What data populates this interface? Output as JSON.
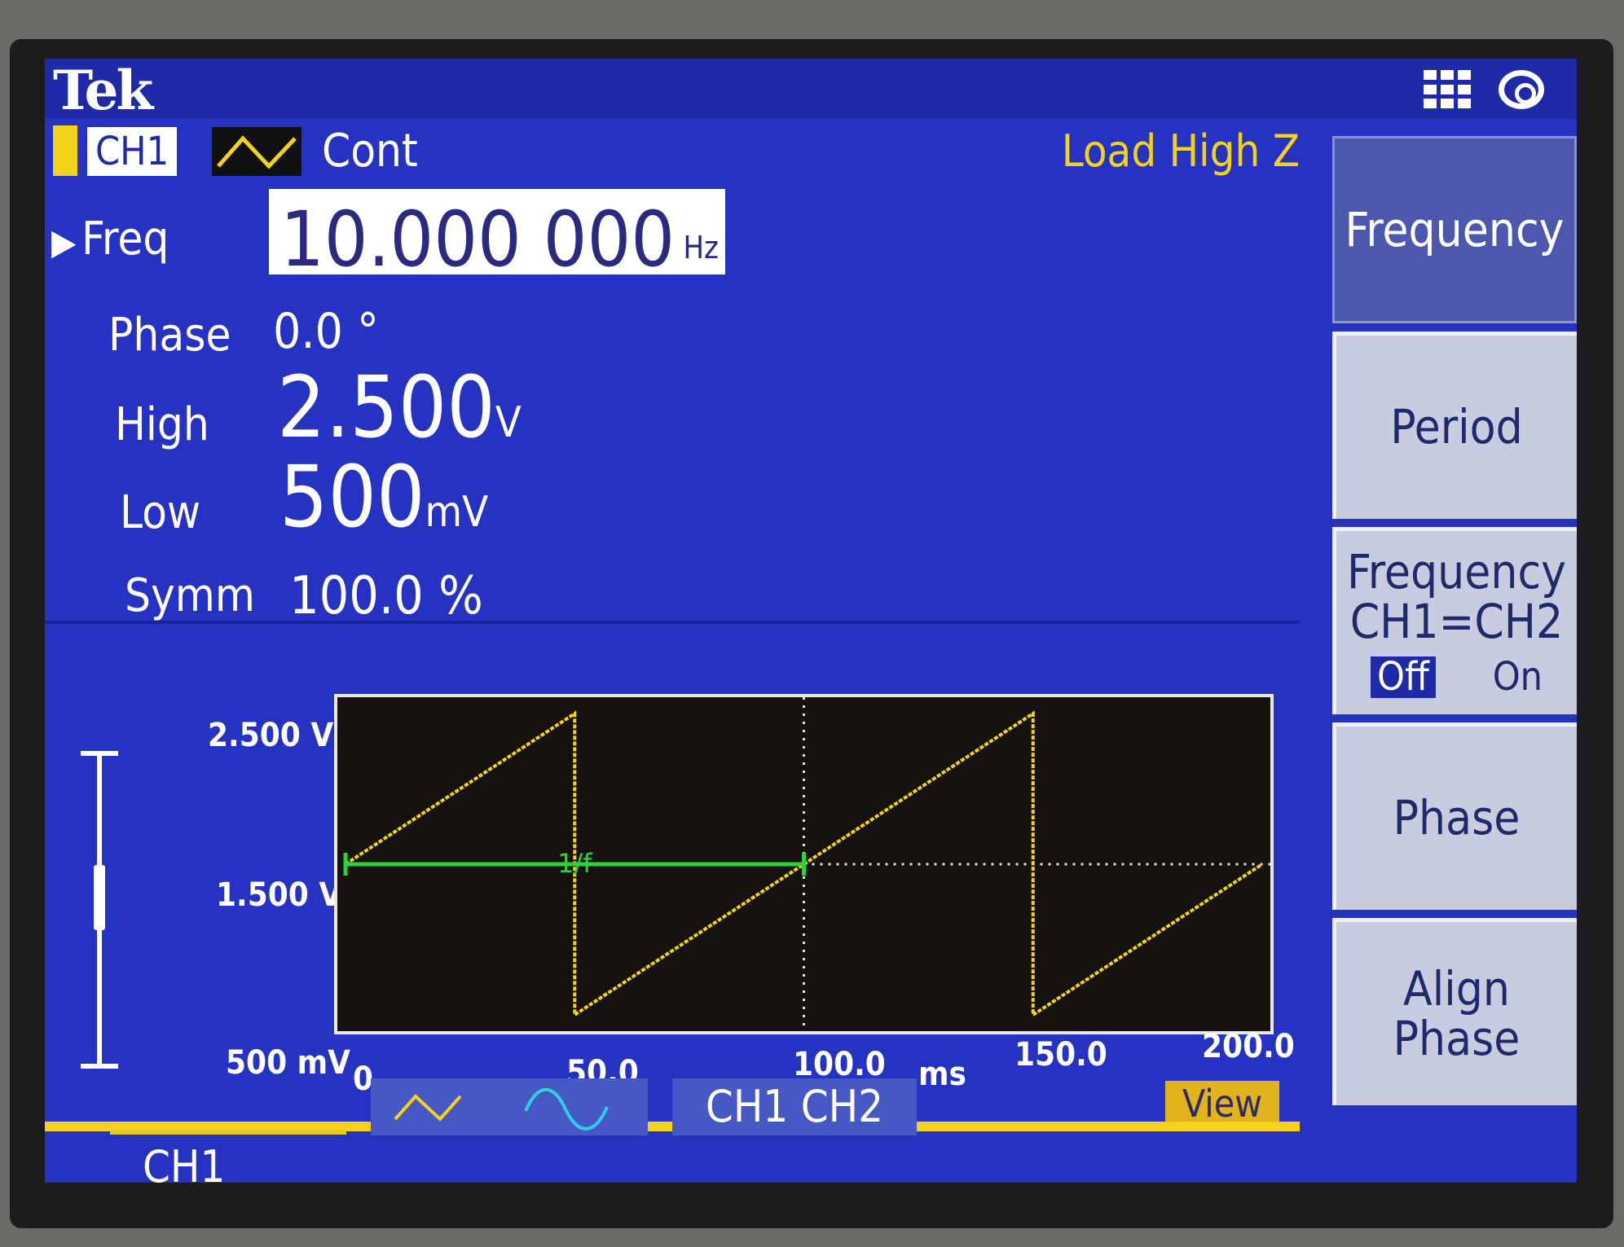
{
  "brand": "Tek",
  "colors": {
    "screen_bg": "#2632c2",
    "ch1_yellow": "#f2d21a",
    "measure_green": "#2bd23a",
    "ch2_cyan": "#2fd0e6"
  },
  "status": {
    "channel": "CH1",
    "mode": "Cont",
    "load": "Load High Z",
    "waveform_icon": "ramp-wave-icon"
  },
  "params": {
    "freq": {
      "label": "Freq",
      "value": "10.000 000",
      "unit": "Hz"
    },
    "phase": {
      "label": "Phase",
      "value": "0.0",
      "unit": "°"
    },
    "high": {
      "label": "High",
      "value": "2.500",
      "unit": "V"
    },
    "low": {
      "label": "Low",
      "value": "500",
      "unit": "mV"
    },
    "symm": {
      "label": "Symm",
      "value": "100.0",
      "unit": "%"
    }
  },
  "menu": {
    "frequency": "Frequency",
    "period": "Period",
    "freq_ch_line1": "Frequency",
    "freq_ch_line2": "CH1=CH2",
    "off": "Off",
    "on": "On",
    "phase": "Phase",
    "align_phase": "Align Phase"
  },
  "tabs": {
    "ch1": "CH1",
    "ch12": "CH1  CH2",
    "view": "View"
  },
  "chart_data": {
    "type": "line",
    "series": [
      {
        "x": [
          0,
          50,
          50,
          150,
          150,
          200
        ],
        "y": [
          1.5,
          2.5,
          0.5,
          2.5,
          0.5,
          1.5
        ]
      }
    ],
    "period_marker": {
      "x_start": 0,
      "x_end": 100,
      "y": 1.5,
      "label": "1/f"
    },
    "y_ticks": [
      "2.500 V",
      "1.500 V",
      "500 mV"
    ],
    "x_ticks": [
      "0",
      "50.0",
      "100.0",
      "150.0",
      "200.0"
    ],
    "x_unit": "ms",
    "xlim": [
      0,
      200
    ],
    "ylim": [
      0.5,
      2.5
    ]
  }
}
